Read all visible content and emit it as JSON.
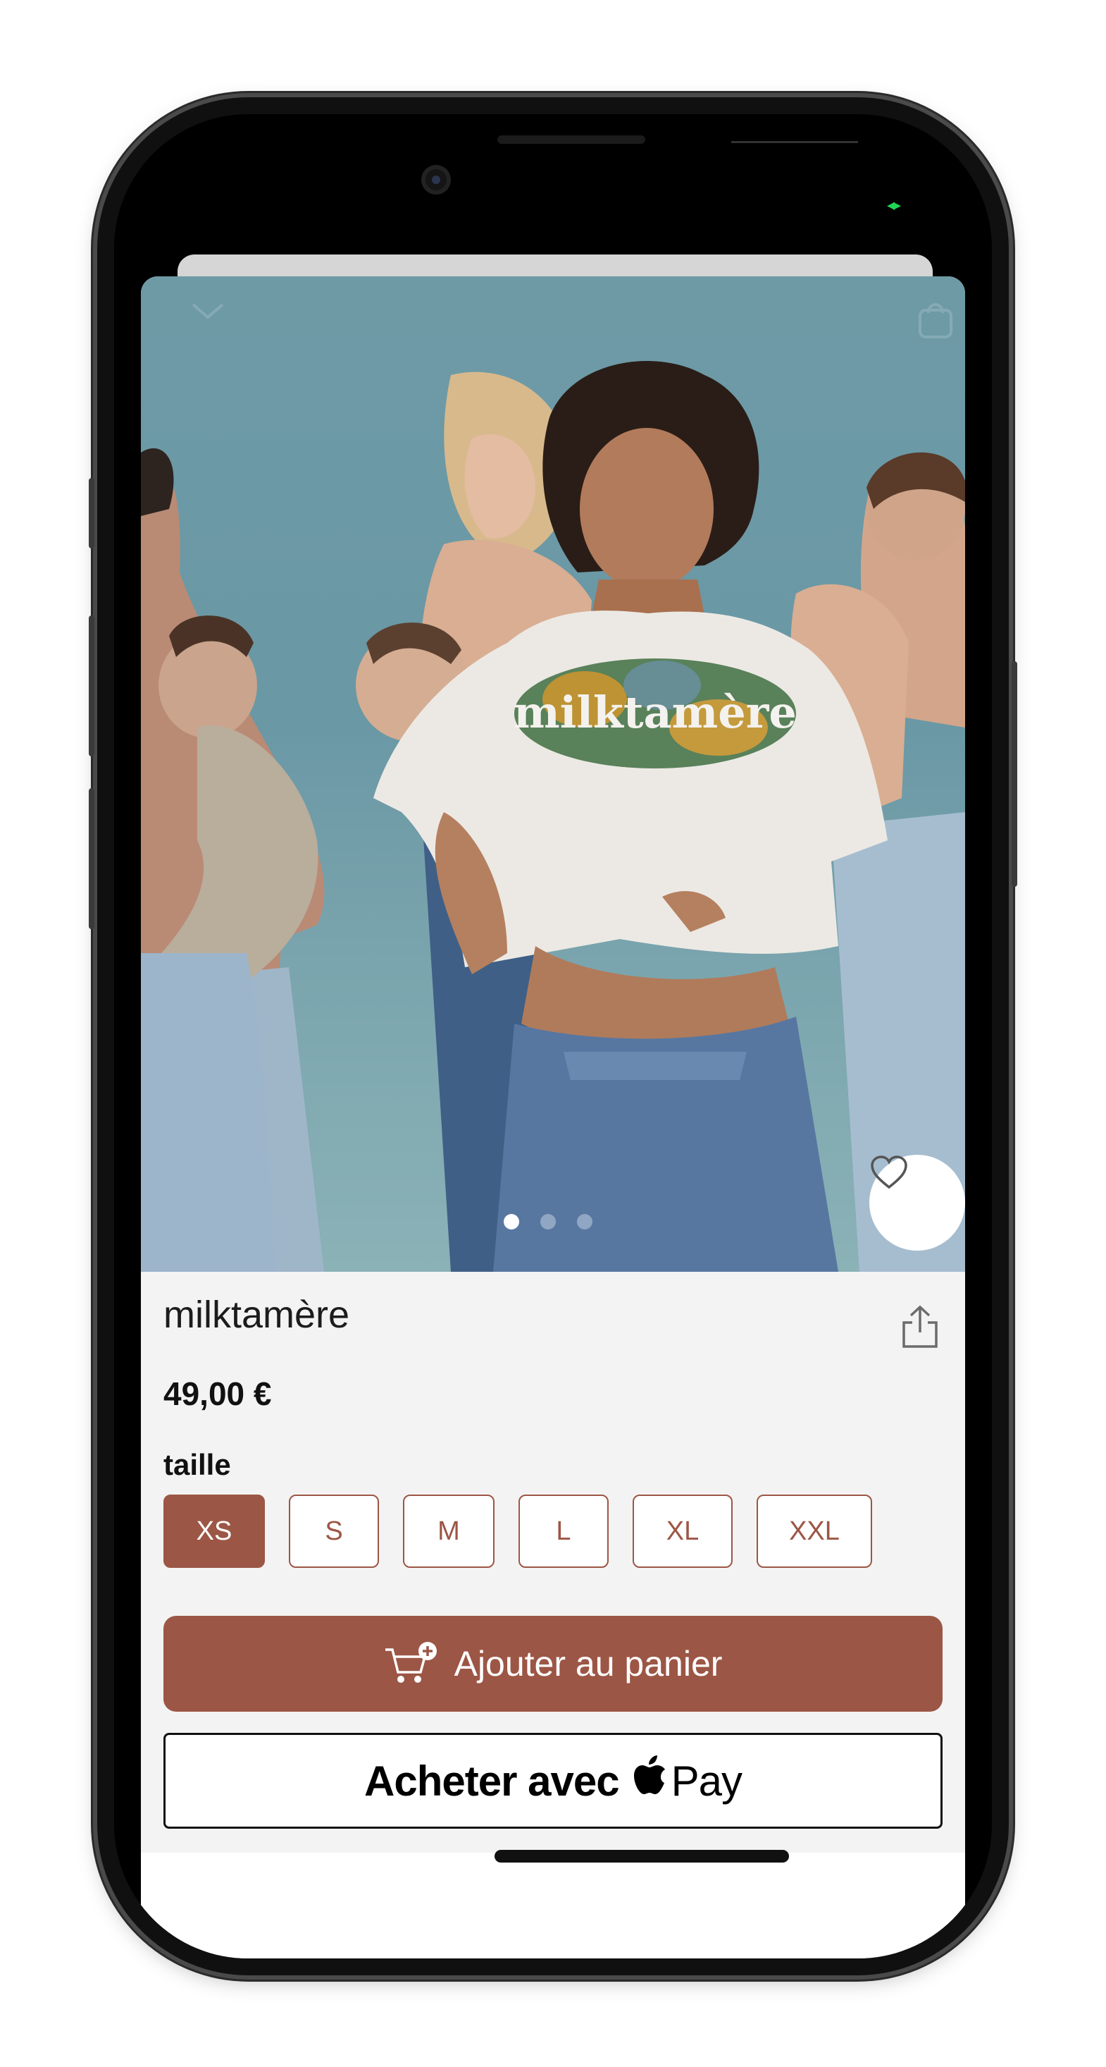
{
  "status_bar": {
    "battery_icon": "battery-charging-icon"
  },
  "hero": {
    "icons": {
      "collapse": "chevron-down-icon",
      "bag": "shopping-bag-icon",
      "favorite": "heart-icon"
    },
    "carousel_pages": 3,
    "carousel_active": 1,
    "shirt_print": "milktamère"
  },
  "product": {
    "name": "milktamère",
    "price": "49,00 €",
    "size_label": "taille",
    "sizes": [
      "XS",
      "S",
      "M",
      "L",
      "XL",
      "XXL"
    ],
    "selected_size": "XS"
  },
  "actions": {
    "add_to_cart": "Ajouter au panier",
    "apple_pay_prefix": "Acheter avec",
    "apple_pay_suffix": "Pay"
  },
  "colors": {
    "accent": "#9c5645",
    "background": "#f3f3f3",
    "hero_bg": "#6e9aa6"
  }
}
